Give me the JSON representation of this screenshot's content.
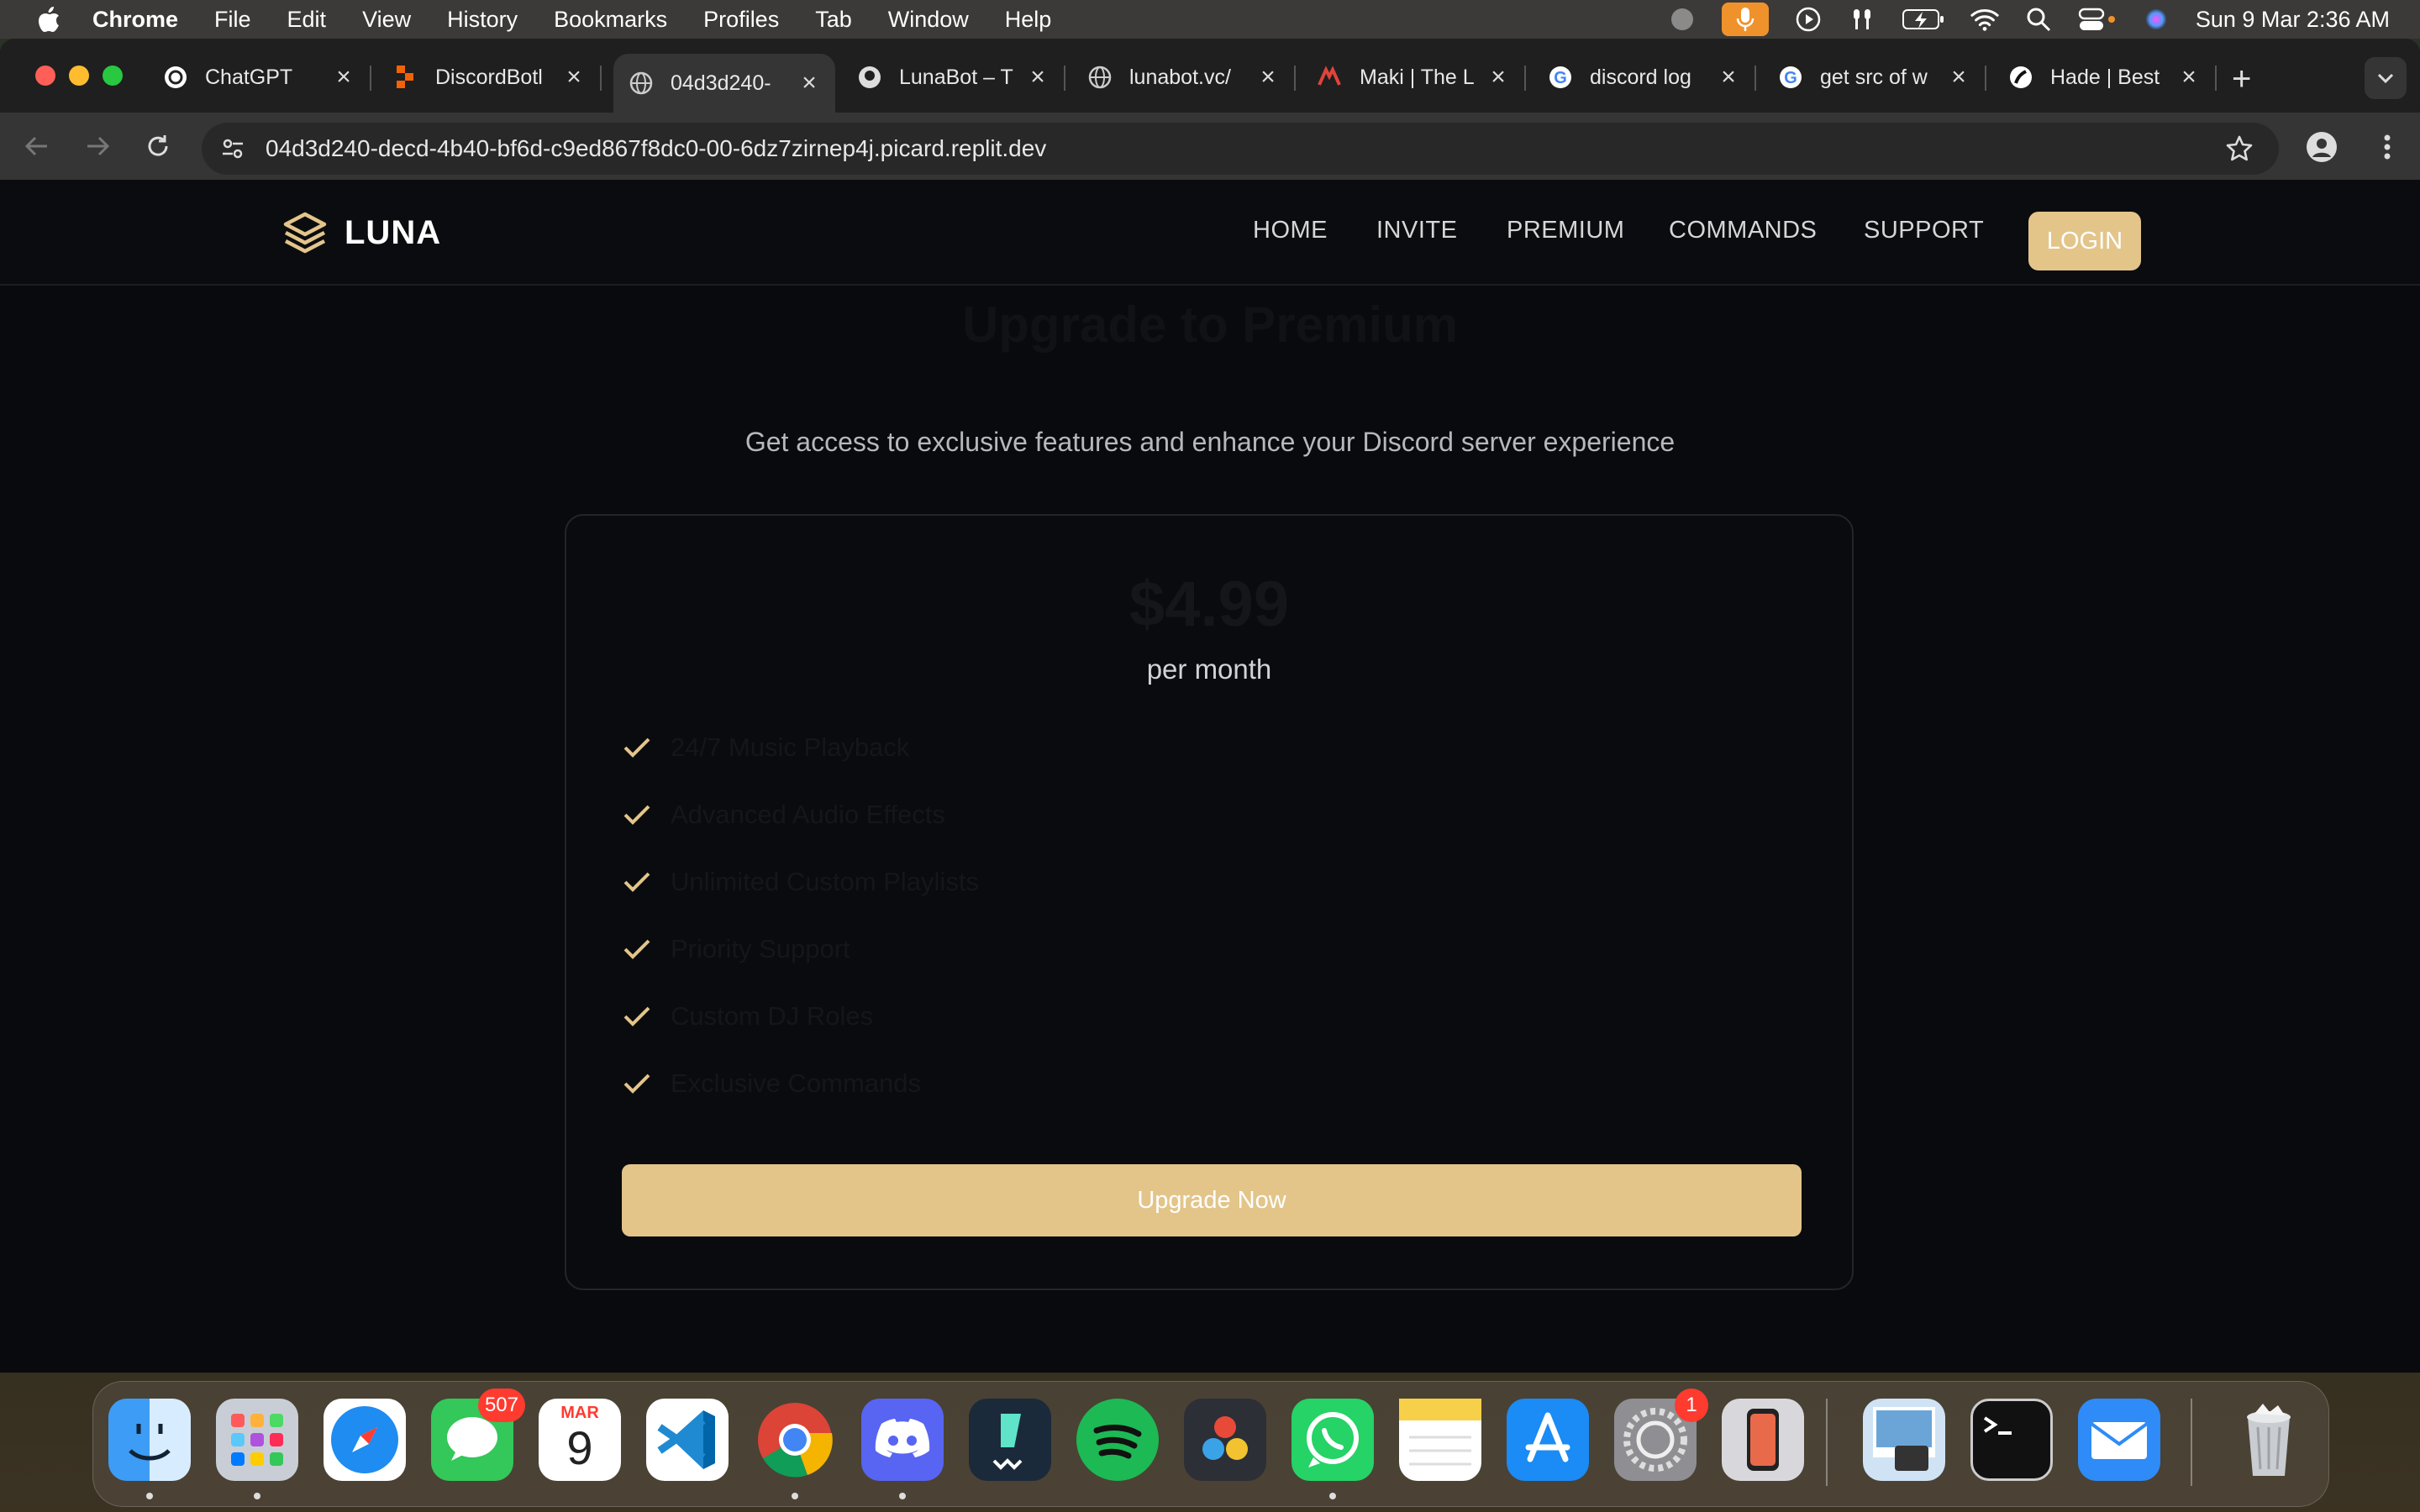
{
  "menubar": {
    "app_name": "Chrome",
    "items": [
      "File",
      "Edit",
      "View",
      "History",
      "Bookmarks",
      "Profiles",
      "Tab",
      "Window",
      "Help"
    ],
    "clock": "Sun 9 Mar  2:36 AM",
    "status_icons": [
      "record-icon",
      "microphone-icon",
      "play-icon",
      "airpods-icon",
      "battery-charging-icon",
      "wifi-icon",
      "search-icon",
      "control-center-icon",
      "siri-icon"
    ]
  },
  "browser": {
    "tabs": [
      {
        "title": "ChatGPT",
        "icon": "chatgpt-icon"
      },
      {
        "title": "DiscordBotl",
        "icon": "replit-icon"
      },
      {
        "title": "04d3d240-",
        "icon": "globe-icon"
      },
      {
        "title": "LunaBot – T",
        "icon": "github-icon"
      },
      {
        "title": "lunabot.vc/",
        "icon": "globe-icon"
      },
      {
        "title": "Maki | The L",
        "icon": "maki-icon"
      },
      {
        "title": "discord log",
        "icon": "google-icon"
      },
      {
        "title": "get src of w",
        "icon": "google-icon"
      },
      {
        "title": "Hade | Best",
        "icon": "hade-icon"
      }
    ],
    "active_tab_index": 2,
    "url": "04d3d240-decd-4b40-bf6d-c9ed867f8dc0-00-6dz7zirnep4j.picard.replit.dev"
  },
  "site": {
    "brand": "LUNA",
    "nav": [
      "HOME",
      "INVITE",
      "PREMIUM",
      "COMMANDS",
      "SUPPORT"
    ],
    "login_label": "LOGIN",
    "accent": "#e3c58a",
    "headline": "Upgrade to Premium",
    "subheadline": "Get access to exclusive features and enhance your Discord server experience",
    "plan": {
      "price": "$4.99",
      "period": "per month",
      "features": [
        "24/7 Music Playback",
        "Advanced Audio Effects",
        "Unlimited Custom Playlists",
        "Priority Support",
        "Custom DJ Roles",
        "Exclusive Commands"
      ],
      "cta": "Upgrade Now"
    }
  },
  "dock": {
    "apps": [
      {
        "name": "Finder",
        "icon": "finder-icon",
        "running": true
      },
      {
        "name": "Launchpad",
        "icon": "launchpad-icon",
        "running": true
      },
      {
        "name": "Safari",
        "icon": "safari-icon",
        "running": false
      },
      {
        "name": "Messages",
        "icon": "messages-icon",
        "badge": "507",
        "running": false
      },
      {
        "name": "Calendar",
        "icon": "calendar-icon",
        "month": "MAR",
        "day": "9",
        "running": false
      },
      {
        "name": "Visual Studio Code",
        "icon": "vscode-icon",
        "running": false
      },
      {
        "name": "Chrome",
        "icon": "chrome-icon",
        "running": true
      },
      {
        "name": "Discord",
        "icon": "discord-icon",
        "running": true
      },
      {
        "name": "Filmora",
        "icon": "filmora-icon",
        "running": false
      },
      {
        "name": "Spotify",
        "icon": "spotify-icon",
        "running": false
      },
      {
        "name": "DaVinci Resolve",
        "icon": "davinci-icon",
        "running": false
      },
      {
        "name": "WhatsApp",
        "icon": "whatsapp-icon",
        "running": true
      },
      {
        "name": "Notes",
        "icon": "notes-icon",
        "running": false
      },
      {
        "name": "App Store",
        "icon": "appstore-icon",
        "running": false
      },
      {
        "name": "System Settings",
        "icon": "settings-icon",
        "badge": "1",
        "running": false
      },
      {
        "name": "iPhone Mirroring",
        "icon": "iphone-icon",
        "running": false
      },
      {
        "name": "Preview",
        "icon": "preview-icon",
        "running": false
      },
      {
        "name": "Terminal",
        "icon": "terminal-icon",
        "running": false
      },
      {
        "name": "Mail",
        "icon": "mail-icon",
        "running": false
      },
      {
        "name": "Trash",
        "icon": "trash-icon",
        "running": false
      }
    ]
  }
}
